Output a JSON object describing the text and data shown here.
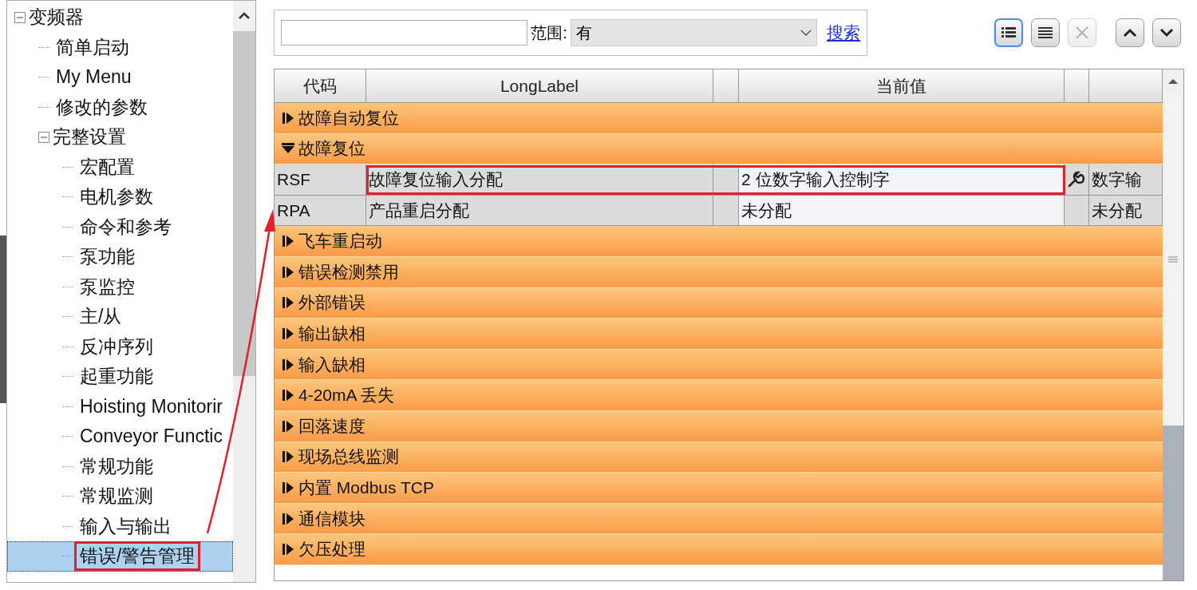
{
  "tree": {
    "items": [
      {
        "label": "变频器",
        "expanded": true,
        "selected": false,
        "children": [
          {
            "label": "简单启动",
            "selected": false
          },
          {
            "label": "My Menu",
            "selected": false
          },
          {
            "label": "修改的参数",
            "selected": false
          },
          {
            "label": "完整设置",
            "expanded": true,
            "selected": false,
            "children": [
              {
                "label": "宏配置",
                "selected": false
              },
              {
                "label": "电机参数",
                "selected": false
              },
              {
                "label": "命令和参考",
                "selected": false
              },
              {
                "label": "泵功能",
                "selected": false
              },
              {
                "label": "泵监控",
                "selected": false
              },
              {
                "label": "主/从",
                "selected": false
              },
              {
                "label": "反冲序列",
                "selected": false
              },
              {
                "label": "起重功能",
                "selected": false
              },
              {
                "label": "Hoisting Monitorir",
                "selected": false
              },
              {
                "label": "Conveyor Functic",
                "selected": false
              },
              {
                "label": "常规功能",
                "selected": false
              },
              {
                "label": "常规监测",
                "selected": false
              },
              {
                "label": "输入与输出",
                "selected": false
              },
              {
                "label": "错误/警告管理",
                "selected": true,
                "annotated": true
              }
            ]
          }
        ]
      }
    ]
  },
  "search": {
    "scope_label": "范围:",
    "scope_value": "有",
    "link": "搜索"
  },
  "toolbar": [
    {
      "kind": "details",
      "selected": true,
      "disabled": false
    },
    {
      "kind": "list",
      "selected": false,
      "disabled": false
    },
    {
      "kind": "tools",
      "selected": false,
      "disabled": true
    },
    {
      "kind": "up",
      "selected": false,
      "disabled": false
    },
    {
      "kind": "down",
      "selected": false,
      "disabled": false
    }
  ],
  "table": {
    "columns": [
      "代码",
      "LongLabel",
      "",
      "当前值",
      "",
      ""
    ],
    "rows": [
      {
        "kind": "group",
        "label": "故障自动复位",
        "expanded": false
      },
      {
        "kind": "group",
        "label": "故障复位",
        "expanded": true
      },
      {
        "kind": "param",
        "code": "RSF",
        "label": "故障复位输入分配",
        "value": "2 位数字输入控制字",
        "tool": true,
        "column_6": "数字输",
        "annotated": true
      },
      {
        "kind": "param",
        "code": "RPA",
        "label": "产品重启分配",
        "value": "未分配",
        "tool": false,
        "column_6": "未分配",
        "annotated": false
      },
      {
        "kind": "group",
        "label": "飞车重启动",
        "expanded": false
      },
      {
        "kind": "group",
        "label": "错误检测禁用",
        "expanded": false
      },
      {
        "kind": "group",
        "label": "外部错误",
        "expanded": false
      },
      {
        "kind": "group",
        "label": "输出缺相",
        "expanded": false
      },
      {
        "kind": "group",
        "label": "输入缺相",
        "expanded": false
      },
      {
        "kind": "group",
        "label": "4-20mA 丢失",
        "expanded": false
      },
      {
        "kind": "group",
        "label": "回落速度",
        "expanded": false
      },
      {
        "kind": "group",
        "label": "现场总线监测",
        "expanded": false
      },
      {
        "kind": "group",
        "label": "内置 Modbus TCP",
        "expanded": false
      },
      {
        "kind": "group",
        "label": "通信模块",
        "expanded": false
      },
      {
        "kind": "group",
        "label": "欠压处理",
        "expanded": false
      }
    ]
  }
}
